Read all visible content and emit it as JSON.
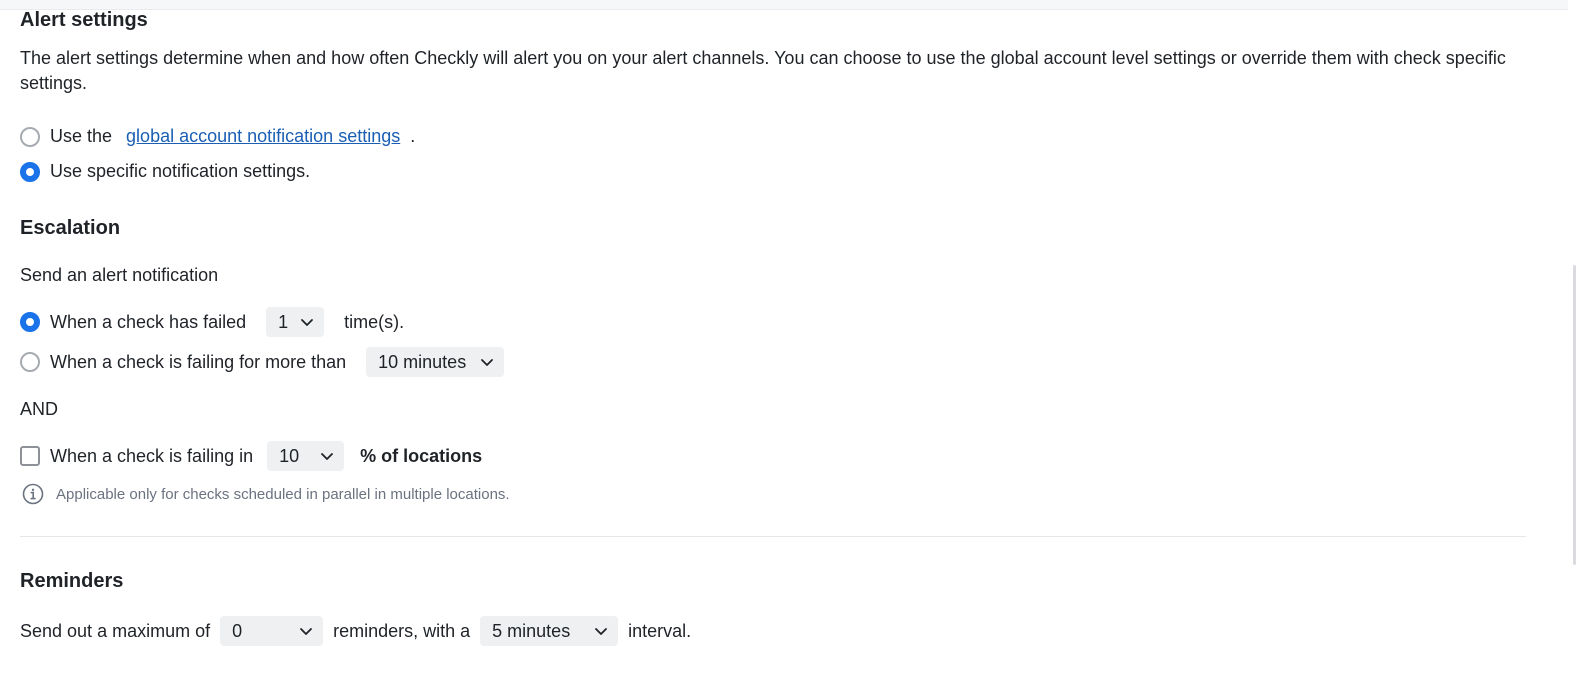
{
  "alert_settings": {
    "title": "Alert settings",
    "description": "The alert settings determine when and how often Checkly will alert you on your alert channels. You can choose to use the global account level settings or override them with check specific settings.",
    "option_global_prefix": "Use the",
    "option_global_link": "global account notification settings",
    "option_global_suffix": ".",
    "option_specific": "Use specific notification settings.",
    "selected": "specific"
  },
  "escalation": {
    "title": "Escalation",
    "subtitle": "Send an alert notification",
    "failed_label": "When a check has failed",
    "failed_count": "1",
    "failed_suffix": "time(s).",
    "failing_label": "When a check is failing for more than",
    "failing_duration": "10 minutes",
    "selected": "failed",
    "and_label": "AND",
    "locations_label": "When a check is failing in",
    "locations_value": "10",
    "locations_suffix": "% of locations",
    "locations_checked": false,
    "hint": "Applicable only for checks scheduled in parallel in multiple locations."
  },
  "reminders": {
    "title": "Reminders",
    "prefix": "Send out a maximum of",
    "max_value": "0",
    "middle": "reminders, with a",
    "interval_value": "5 minutes",
    "suffix": "interval."
  },
  "icons": {
    "chevron": "chevron-down-icon",
    "info": "info-icon"
  },
  "colors": {
    "accent": "#1a73e8",
    "link": "#1a5fb4"
  }
}
